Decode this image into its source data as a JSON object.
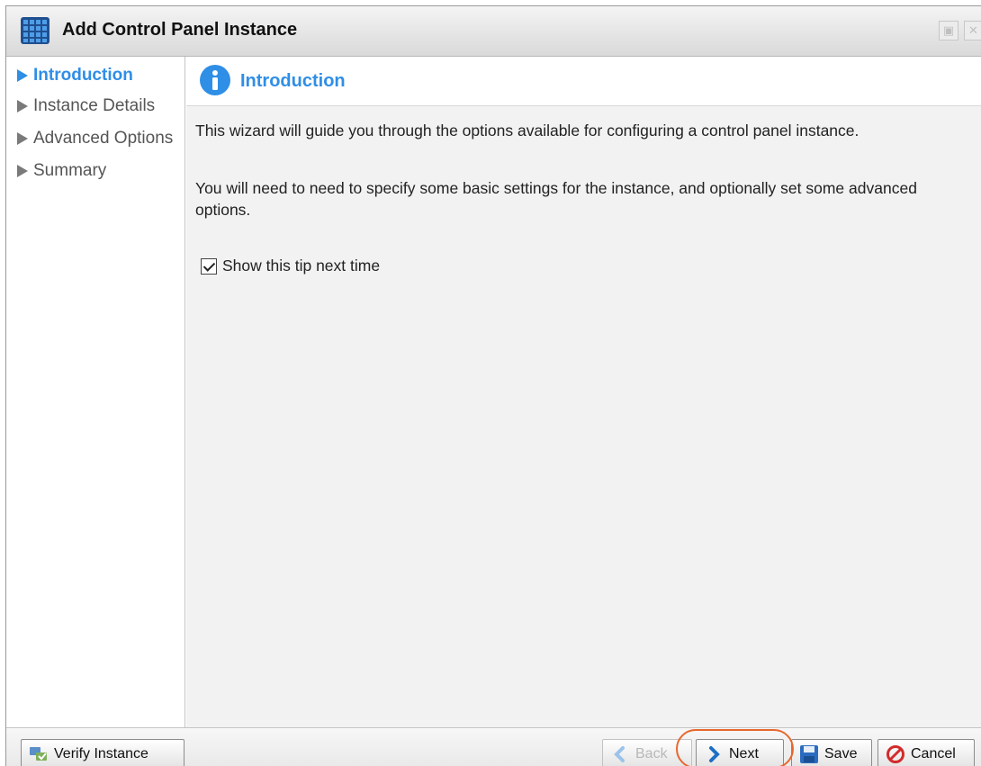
{
  "window": {
    "title": "Add Control Panel Instance"
  },
  "sidebar": {
    "items": [
      {
        "label": "Introduction",
        "active": true
      },
      {
        "label": "Instance Details",
        "active": false
      },
      {
        "label": "Advanced Options",
        "active": false
      },
      {
        "label": "Summary",
        "active": false
      }
    ]
  },
  "main": {
    "title": "Introduction",
    "paragraphs": [
      "This wizard will guide you through the options available for configuring a control panel instance.",
      "You will need to need to specify some basic settings for the instance, and optionally set some advanced options."
    ],
    "show_tip": {
      "label": "Show this tip next time",
      "checked": true
    }
  },
  "footer": {
    "verify_label": "Verify Instance",
    "back_label": "Back",
    "next_label": "Next",
    "save_label": "Save",
    "cancel_label": "Cancel"
  },
  "colors": {
    "accent": "#2f8ee6",
    "highlight_ring": "#e8672e",
    "cancel_icon": "#d42a2a"
  },
  "icons": {
    "title": "control-panel-grid-icon",
    "header": "info-icon",
    "verify": "verify-instance-icon",
    "back": "chevron-left-icon",
    "next": "chevron-right-icon",
    "save": "floppy-disk-icon",
    "cancel": "no-entry-icon"
  }
}
